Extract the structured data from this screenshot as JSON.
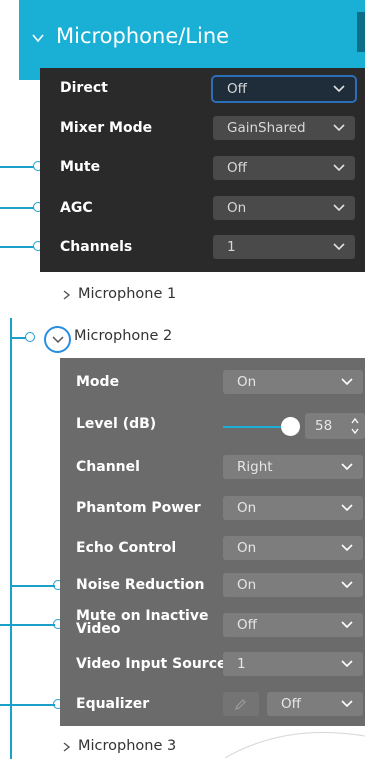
{
  "header": {
    "title": "Microphone/Line"
  },
  "top_panel": {
    "rows": [
      {
        "label": "Direct",
        "value": "Off"
      },
      {
        "label": "Mixer Mode",
        "value": "GainShared"
      },
      {
        "label": "Mute",
        "value": "Off"
      },
      {
        "label": "AGC",
        "value": "On"
      },
      {
        "label": "Channels",
        "value": "1"
      }
    ]
  },
  "tree": {
    "microphone1": "Microphone 1",
    "microphone2": "Microphone 2",
    "microphone3": "Microphone 3"
  },
  "mic2_panel": {
    "mode": {
      "label": "Mode",
      "value": "On"
    },
    "level": {
      "label": "Level (dB)",
      "value": "58",
      "slider_fraction": 1.0
    },
    "channel": {
      "label": "Channel",
      "value": "Right"
    },
    "phantom": {
      "label": "Phantom Power",
      "value": "On"
    },
    "echo": {
      "label": "Echo Control",
      "value": "On"
    },
    "noise": {
      "label": "Noise Reduction",
      "value": "On"
    },
    "mute_inactive": {
      "label": "Mute on Inactive Video",
      "value": "Off"
    },
    "video_input": {
      "label": "Video Input Source",
      "value": "1"
    },
    "equalizer": {
      "label": "Equalizer",
      "value": "Off"
    }
  },
  "colors": {
    "accent": "#1ab0d6",
    "connector": "#1aa0c9",
    "dark_panel": "#2a2a2a",
    "gray_panel": "#6b6b6b"
  }
}
